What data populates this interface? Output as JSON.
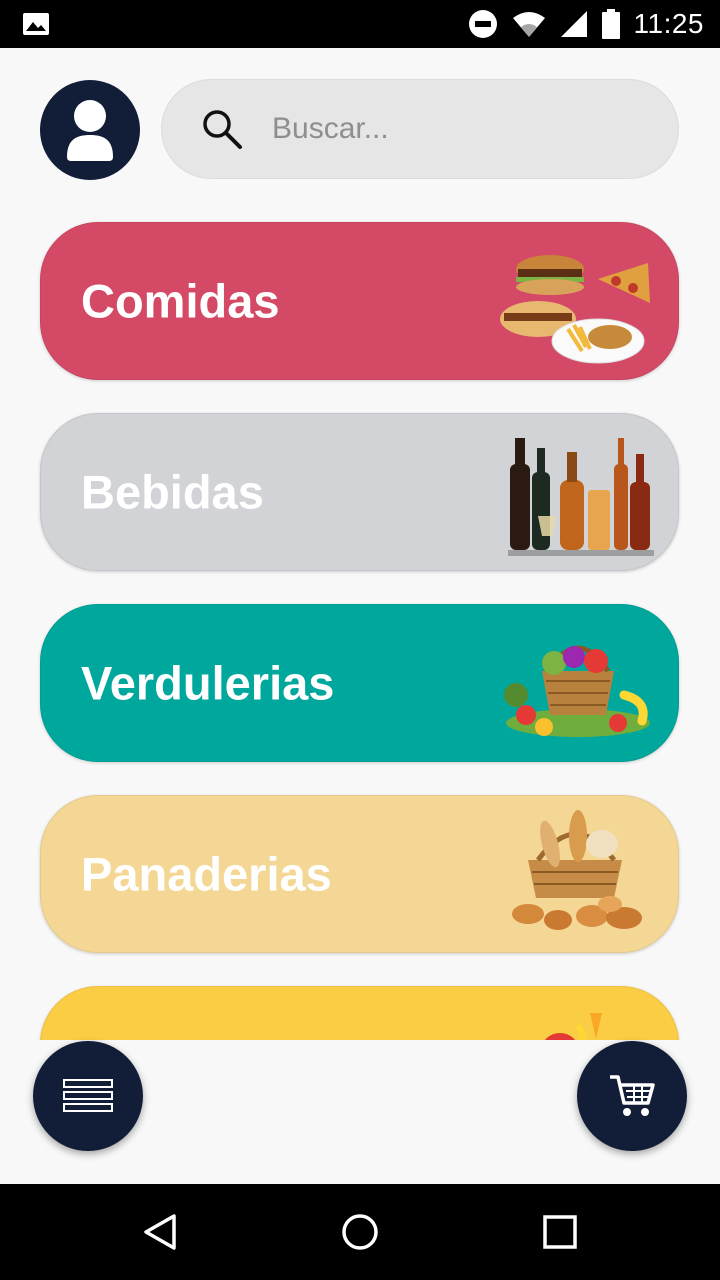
{
  "status_bar": {
    "time": "11:25",
    "icons": [
      "gallery-icon",
      "do-not-disturb-icon",
      "wifi-icon",
      "signal-icon",
      "battery-icon"
    ]
  },
  "search": {
    "placeholder": "Buscar..."
  },
  "categories": [
    {
      "label": "Comidas",
      "color": "#d44a66",
      "icon": "food-platter-image"
    },
    {
      "label": "Bebidas",
      "color": "#d2d3d6",
      "icon": "drinks-bottles-image"
    },
    {
      "label": "Verdulerias",
      "color": "#00a79c",
      "icon": "vegetable-basket-image"
    },
    {
      "label": "Panaderias",
      "color": "#f4d795",
      "icon": "bread-basket-image"
    },
    {
      "label": "",
      "color": "#fbcd44",
      "icon": "grocery-image"
    }
  ],
  "colors": {
    "accent_dark": "#121d38",
    "background": "#f8f8f8"
  },
  "fabs": {
    "menu_icon": "menu-icon",
    "cart_icon": "cart-icon"
  },
  "nav": [
    "back-icon",
    "home-icon",
    "recents-icon"
  ]
}
